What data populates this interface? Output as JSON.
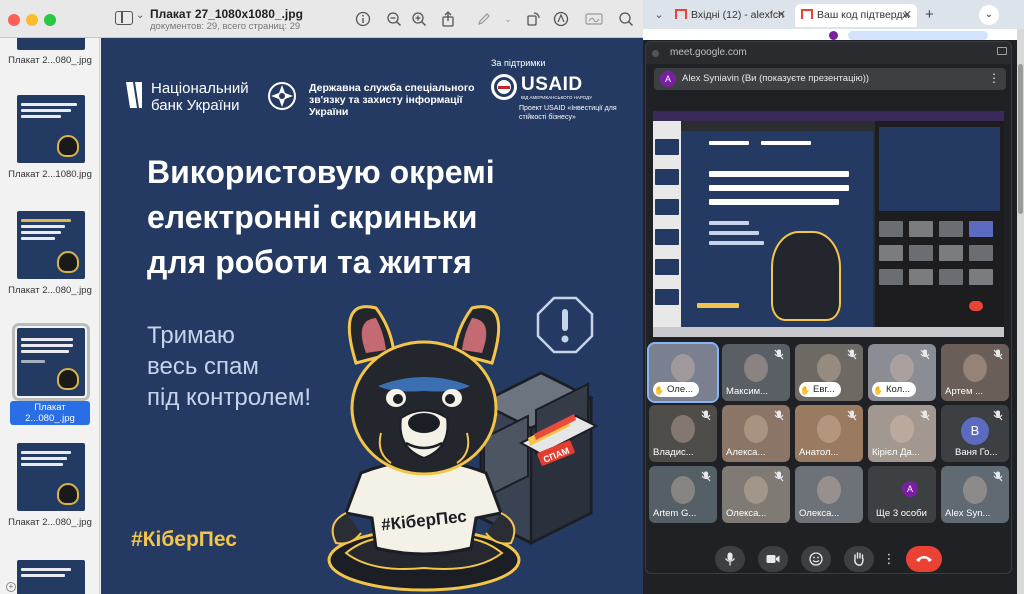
{
  "preview": {
    "title": "Плакат 27_1080x1080_.jpg",
    "subtitle": "документов: 29, всего страниц: 29",
    "thumbnails": [
      {
        "label": "Плакат 2...080_.jpg",
        "selected": false
      },
      {
        "label": "Плакат 2...1080.jpg",
        "selected": false
      },
      {
        "label": "Плакат 2...080_.jpg",
        "selected": false
      },
      {
        "label": "Плакат 2...080_.jpg",
        "selected": true
      },
      {
        "label": "Плакат 2...080_.jpg",
        "selected": false
      }
    ]
  },
  "poster": {
    "nbu_name": "Національний банк України",
    "nbu_line1": "Національний",
    "nbu_line2": "банк України",
    "dss_name": "Державна служба спеціального зв'язку та захисту інформації України",
    "support_label": "За підтримки",
    "usaid": "USAID",
    "usaid_sub": "ВІД АМЕРИКАНСЬКОГО НАРОДУ",
    "project": "Проект USAID «Інвестиції для стійкості бізнесу»",
    "headline_1": "Використовую окремі",
    "headline_2": "електронні скриньки",
    "headline_3": "для роботи та життя",
    "subhead_1": "Тримаю",
    "subhead_2": "весь спам",
    "subhead_3": "під контролем!",
    "spam_label": "СПАМ",
    "shirt_text": "#КіберПес",
    "hashtag": "#КіберПес"
  },
  "chrome": {
    "tabs": [
      {
        "label": "Вхідні (12) - alexfcn",
        "active": false
      },
      {
        "label": "Ваш код підтвердж",
        "active": true
      }
    ],
    "tab_menu": "⌄"
  },
  "meet": {
    "url": "meet.google.com",
    "presenter_initial": "A",
    "presenter_text": "Alex Syniavin (Ви (показуєте презентацію))",
    "participants": [
      {
        "name": "Оле...",
        "muted": false,
        "hand": true,
        "speaker": true,
        "bg": "#7a8090"
      },
      {
        "name": "Максим...",
        "muted": true,
        "hand": false,
        "speaker": false,
        "bg": "#5a5f66"
      },
      {
        "name": "Евг...",
        "muted": true,
        "hand": true,
        "speaker": false,
        "bg": "#6e6a63"
      },
      {
        "name": "Кол...",
        "muted": true,
        "hand": true,
        "speaker": false,
        "bg": "#8a8d93"
      },
      {
        "name": "Артем ...",
        "muted": true,
        "hand": false,
        "speaker": false,
        "bg": "#6a5e58"
      },
      {
        "name": "Владис...",
        "muted": true,
        "hand": false,
        "speaker": false,
        "bg": "#4f4d4a"
      },
      {
        "name": "Алекса...",
        "muted": true,
        "hand": false,
        "speaker": false,
        "bg": "#8a7566"
      },
      {
        "name": "Анатол...",
        "muted": true,
        "hand": false,
        "speaker": false,
        "bg": "#9a7b62"
      },
      {
        "name": "Кірієл Да...",
        "muted": true,
        "hand": false,
        "speaker": false,
        "bg": "#a39890"
      },
      {
        "name": "Ваня Го...",
        "muted": true,
        "hand": false,
        "speaker": false,
        "bg": "#3c4043",
        "initial": "В"
      },
      {
        "name": "Artem G...",
        "muted": true,
        "hand": false,
        "speaker": false,
        "bg": "#556066"
      },
      {
        "name": "Олекса...",
        "muted": true,
        "hand": false,
        "speaker": false,
        "bg": "#7f7a74"
      },
      {
        "name": "Олекса...",
        "muted": false,
        "hand": false,
        "speaker": false,
        "bg": "#6d7278"
      },
      {
        "name": "Ще 3 особи",
        "muted": false,
        "hand": false,
        "speaker": false,
        "bg": "#3c4043",
        "initial": "A"
      },
      {
        "name": "Alex Syn...",
        "muted": true,
        "hand": false,
        "speaker": false,
        "bg": "#5f6a72"
      }
    ]
  },
  "colors": {
    "poster_bg": "#243a63",
    "accent_yellow": "#f3c54a",
    "meet_end": "#ea4335",
    "selection_blue": "#2a6ee6"
  }
}
